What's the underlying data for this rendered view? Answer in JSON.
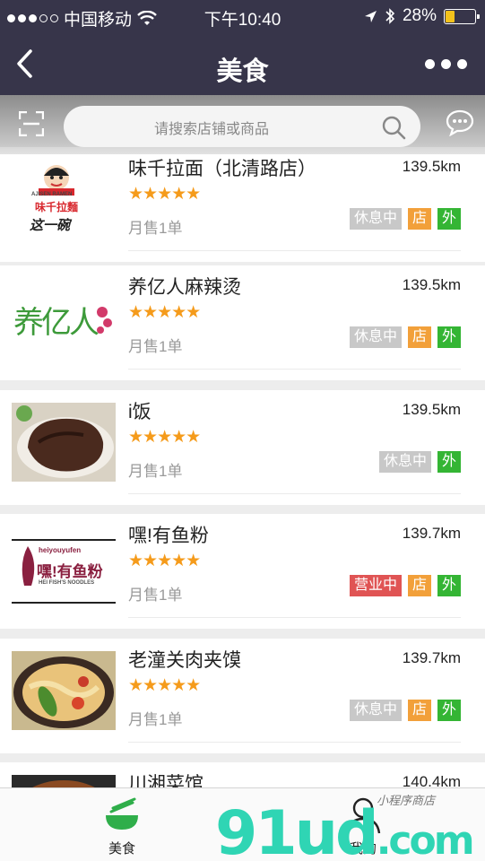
{
  "status_bar": {
    "carrier": "中国移动",
    "time": "下午10:40",
    "battery": "28%",
    "battery_level": 0.28
  },
  "nav": {
    "title": "美食"
  },
  "search": {
    "placeholder": "请搜索店铺或商品"
  },
  "stores": [
    {
      "name": "味千拉面（北清路店）",
      "distance": "139.5km",
      "stars": "★★★★★",
      "sales": "月售1单",
      "status": "休息中",
      "badges": [
        "店",
        "外"
      ]
    },
    {
      "name": "养亿人麻辣烫",
      "distance": "139.5km",
      "stars": "★★★★★",
      "sales": "月售1单",
      "status": "休息中",
      "badges": [
        "店",
        "外"
      ]
    },
    {
      "name": "i饭",
      "distance": "139.5km",
      "stars": "★★★★★",
      "sales": "月售1单",
      "status": "休息中",
      "badges": [
        "外"
      ]
    },
    {
      "name": "嘿!有鱼粉",
      "distance": "139.7km",
      "stars": "★★★★★",
      "sales": "月售1单",
      "status": "营业中",
      "badges": [
        "店",
        "外"
      ]
    },
    {
      "name": "老潼关肉夹馍",
      "distance": "139.7km",
      "stars": "★★★★★",
      "sales": "月售1单",
      "status": "休息中",
      "badges": [
        "店",
        "外"
      ]
    },
    {
      "name": "川湘菜馆",
      "distance": "140.4km"
    }
  ],
  "logos": {
    "weiqian": "味千拉麵",
    "weiqian_en": "AJISEN RAMEN",
    "weiqian_slogan": "这一碗",
    "yangyiren": "养亿人",
    "youyufen": "嘿!有鱼粉",
    "youyufen_top": "heiyouyufen",
    "youyufen_en": "HEI FISH'S NOODLES"
  },
  "tabs": [
    {
      "label": "美食"
    },
    {
      "label": "我的"
    }
  ],
  "watermark": {
    "brand": "91ud",
    "suffix": ".com",
    "tagline": "小程序商店"
  },
  "colors": {
    "header": "#37354a",
    "star": "#f59b1b",
    "resting": "#c8c8c8",
    "open": "#e05454",
    "store_badge": "#f2a03a",
    "takeout_badge": "#34b534",
    "tab_active": "#2fae4a"
  }
}
